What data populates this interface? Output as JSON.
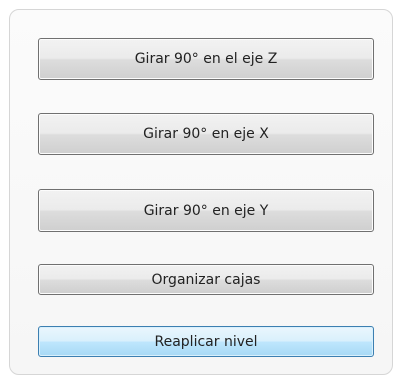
{
  "buttons": {
    "rotate_z": "Girar 90° en el eje Z",
    "rotate_x": "Girar 90° en eje X",
    "rotate_y": "Girar 90° en eje Y",
    "organize": "Organizar cajas",
    "reapply": "Reaplicar nivel"
  }
}
